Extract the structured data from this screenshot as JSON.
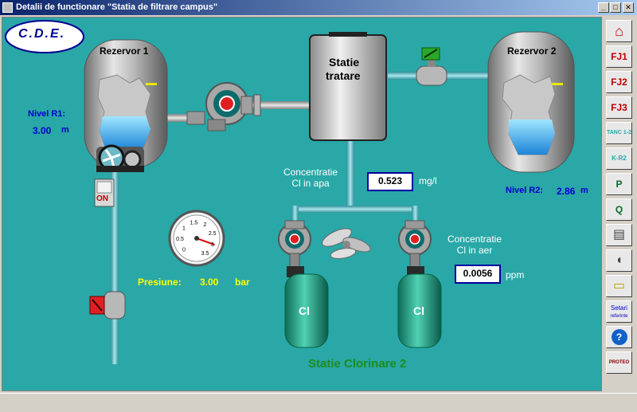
{
  "window": {
    "title": "Detalii de functionare \"Statia de filtrare campus\"",
    "minimize_glyph": "_",
    "maximize_glyph": "□",
    "close_glyph": "✕"
  },
  "logo": {
    "text": "C.D.E."
  },
  "reservoir1": {
    "name": "Rezervor 1",
    "level_label": "Nivel R1:",
    "level_value": "3.00",
    "level_unit": "m",
    "level_fraction": 0.35
  },
  "reservoir2": {
    "name": "Rezervor 2",
    "level_label": "Nivel R2:",
    "level_value": "2.86",
    "level_unit": "m",
    "level_fraction": 0.33
  },
  "treatment": {
    "name_line1": "Statie",
    "name_line2": "tratare"
  },
  "pump_switch": {
    "label": "ON"
  },
  "chlorine_water": {
    "label_line1": "Concentratie",
    "label_line2": "Cl in apa",
    "value": "0.523",
    "unit": "mg/l"
  },
  "chlorine_air": {
    "label_line1": "Concentratie",
    "label_line2": "Cl in aer",
    "value": "0.0056",
    "unit": "ppm"
  },
  "pressure": {
    "label": "Presiune:",
    "value": "3.00",
    "unit": "bar",
    "gauge_ticks": [
      "0",
      "0.5",
      "1",
      "1.5",
      "2",
      "2.5",
      "3",
      "3.5"
    ]
  },
  "cylinders": {
    "left_label": "Cl",
    "right_label": "Cl"
  },
  "station": {
    "title": "Statie Clorinare 2"
  },
  "sidebar": {
    "items": [
      {
        "name": "home",
        "label": "⌂"
      },
      {
        "name": "fj1",
        "label": "FJ1"
      },
      {
        "name": "fj2",
        "label": "FJ2"
      },
      {
        "name": "fj3",
        "label": "FJ3"
      },
      {
        "name": "tanks",
        "label": "TANC 1-2"
      },
      {
        "name": "k-r",
        "label": "K-R2"
      },
      {
        "name": "monitor-p",
        "label": "P"
      },
      {
        "name": "monitor-q",
        "label": "Q"
      },
      {
        "name": "report",
        "label": "▤"
      },
      {
        "name": "speaker",
        "label": "◖"
      },
      {
        "name": "folder",
        "label": "▭"
      },
      {
        "name": "settings",
        "label_line1": "Setari",
        "label_line2": "referinte"
      },
      {
        "name": "help",
        "label": "?"
      },
      {
        "name": "company",
        "label": "PROTEO"
      }
    ]
  },
  "colors": {
    "pipe": "#5fbfc8",
    "water": "#3ec0f0",
    "dark_water": "#1f77d6",
    "tank_gray": "#9a9a9a",
    "cylinder": "#1fa389",
    "station_green": "#1e8c1e"
  }
}
